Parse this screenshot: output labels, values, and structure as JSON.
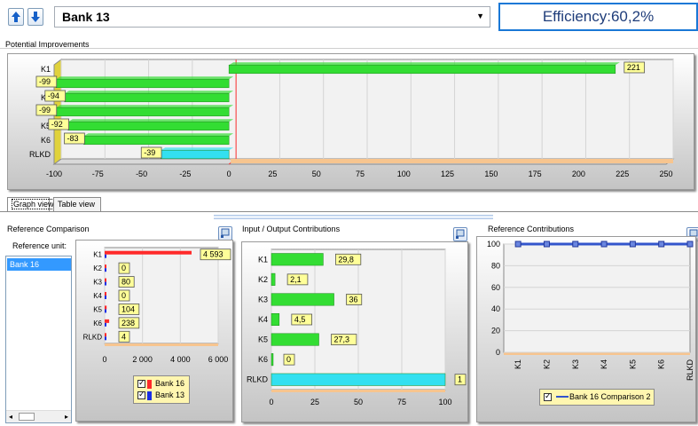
{
  "toolbar": {
    "up_icon": "arrow-up-icon",
    "down_icon": "arrow-down-icon",
    "selected_unit": "Bank 13",
    "efficiency": "Efficiency:60,2%",
    "dropdown_icon": "chevron-down-icon"
  },
  "potential_improvements": {
    "label": "Potential Improvements",
    "chart_data": {
      "type": "bar",
      "orientation": "horizontal",
      "categories": [
        "K1",
        "K2",
        "K3",
        "K4",
        "K5",
        "K6",
        "RLKD"
      ],
      "values": [
        221,
        -99,
        -94,
        -99,
        -92,
        -83,
        -39
      ],
      "value_labels": [
        "221",
        "-99",
        "-94",
        "-99",
        "-92",
        "-83",
        "-39"
      ],
      "colors": [
        "#33dd33",
        "#33dd33",
        "#33dd33",
        "#33dd33",
        "#33dd33",
        "#33dd33",
        "#33e0f0"
      ],
      "xlim": [
        -100,
        250
      ],
      "xticks": [
        "-100",
        "-75",
        "-50",
        "-25",
        "0",
        "25",
        "50",
        "75",
        "100",
        "125",
        "150",
        "175",
        "200",
        "225",
        "250"
      ],
      "xtick_values": [
        -100,
        -75,
        -50,
        -25,
        0,
        25,
        50,
        75,
        100,
        125,
        150,
        175,
        200,
        225,
        250
      ],
      "grid": true
    }
  },
  "tabs": {
    "graph_view": "Graph view",
    "table_view": "Table view"
  },
  "reference_comparison": {
    "label": "Reference Comparison",
    "reference_unit_label": "Reference unit:",
    "reference_units": [
      "Bank 16"
    ],
    "chart_data": {
      "type": "bar",
      "orientation": "horizontal",
      "categories": [
        "K1",
        "K2",
        "K3",
        "K4",
        "K5",
        "K6",
        "RLKD"
      ],
      "series": [
        {
          "name": "Bank 16",
          "color": "#ff2a2a",
          "values": [
            4593,
            0,
            80,
            0,
            104,
            238,
            4
          ]
        },
        {
          "name": "Bank 13",
          "color": "#1a2ee6",
          "values": [
            40,
            60,
            50,
            45,
            55,
            50,
            45
          ]
        }
      ],
      "value_labels": [
        "4 593",
        "0",
        "80",
        "0",
        "104",
        "238",
        "4"
      ],
      "xlim": [
        0,
        6000
      ],
      "xticks": [
        "0",
        "2 000",
        "4 000",
        "6 000"
      ],
      "xtick_values": [
        0,
        2000,
        4000,
        6000
      ]
    },
    "legend": [
      "Bank 16",
      "Bank 13"
    ]
  },
  "io_contributions": {
    "label": "Input / Output Contributions",
    "chart_data": {
      "type": "bar",
      "orientation": "horizontal",
      "categories": [
        "K1",
        "K2",
        "K3",
        "K4",
        "K5",
        "K6",
        "RLKD"
      ],
      "values": [
        29.8,
        2.1,
        36,
        4.5,
        27.3,
        0,
        100
      ],
      "value_labels": [
        "29,8",
        "2,1",
        "36",
        "4,5",
        "27,3",
        "0",
        "1"
      ],
      "colors": [
        "#33dd33",
        "#33dd33",
        "#33dd33",
        "#33dd33",
        "#33dd33",
        "#33dd33",
        "#33e0f0"
      ],
      "xlim": [
        0,
        100
      ],
      "xticks": [
        "0",
        "25",
        "50",
        "75",
        "100"
      ],
      "xtick_values": [
        0,
        25,
        50,
        75,
        100
      ]
    }
  },
  "reference_contributions": {
    "label": "Reference Contributions",
    "chart_data": {
      "type": "line",
      "categories": [
        "K1",
        "K2",
        "K3",
        "K4",
        "K5",
        "K6",
        "RLKD"
      ],
      "series": [
        {
          "name": "Bank 16 Comparison 2",
          "color": "#3355cc",
          "values": [
            100,
            100,
            100,
            100,
            100,
            100,
            100
          ]
        }
      ],
      "ylim": [
        0,
        100
      ],
      "yticks": [
        "0",
        "20",
        "40",
        "60",
        "80",
        "100"
      ],
      "ytick_values": [
        0,
        20,
        40,
        60,
        80,
        100
      ]
    },
    "legend": [
      "Bank 16 Comparison 2"
    ]
  }
}
